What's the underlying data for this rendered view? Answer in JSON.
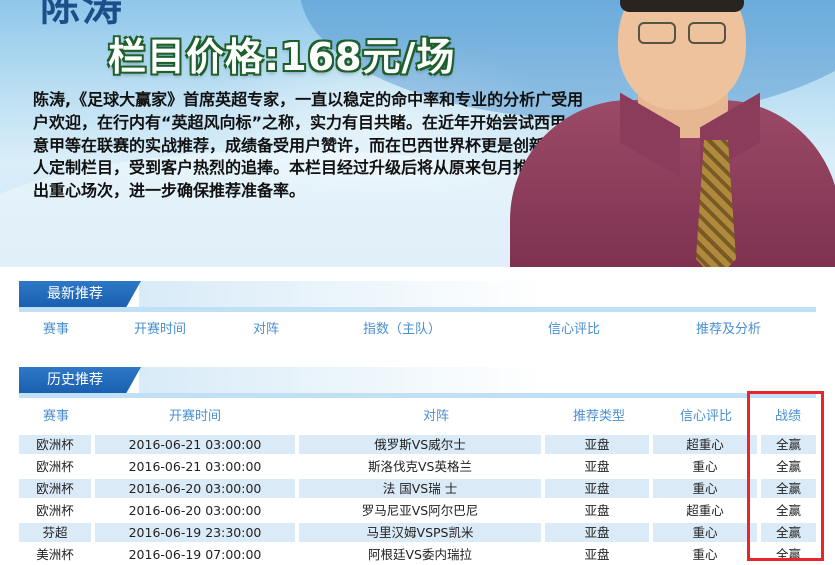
{
  "banner": {
    "top_text": "陈涛",
    "price": "栏目价格:168元/场",
    "description": "陈涛,《足球大赢家》首席英超专家，一直以稳定的命中率和专业的分析广受用户欢迎，在行内有“英超风向标”之称，实力有目共睹。在近年开始尝试西甲、意甲等在联赛的实战推荐，成绩备受用户赞许，而在巴西世界杯更是创新推出私人定制栏目，受到客户热烈的追捧。本栏目经过升级后将从原来包月推荐中精选出重心场次，进一步确保推荐准备率。"
  },
  "latest": {
    "tab": "最新推荐",
    "columns": [
      "赛事",
      "开赛时间",
      "对阵",
      "指数（主队）",
      "信心评比",
      "推荐及分析"
    ]
  },
  "history": {
    "tab": "历史推荐",
    "columns": [
      "赛事",
      "开赛时间",
      "对阵",
      "推荐类型",
      "信心评比",
      "战绩"
    ],
    "rows": [
      [
        "欧洲杯",
        "2016-06-21 03:00:00",
        "俄罗斯VS威尔士",
        "亚盘",
        "超重心",
        "全赢"
      ],
      [
        "欧洲杯",
        "2016-06-21 03:00:00",
        "斯洛伐克VS英格兰",
        "亚盘",
        "重心",
        "全赢"
      ],
      [
        "欧洲杯",
        "2016-06-20 03:00:00",
        "法 国VS瑞 士",
        "亚盘",
        "重心",
        "全赢"
      ],
      [
        "欧洲杯",
        "2016-06-20 03:00:00",
        "罗马尼亚VS阿尔巴尼",
        "亚盘",
        "超重心",
        "全赢"
      ],
      [
        "芬超",
        "2016-06-19 23:30:00",
        "马里汉姆VSPS凯米",
        "亚盘",
        "重心",
        "全赢"
      ],
      [
        "美洲杯",
        "2016-06-19 07:00:00",
        "阿根廷VS委内瑞拉",
        "亚盘",
        "重心",
        "全赢"
      ]
    ]
  },
  "colors": {
    "accent": "#1b5fb0",
    "header_text": "#4a8fd0",
    "row_alt": "#dbeaf7",
    "highlight": "#e8262a"
  }
}
